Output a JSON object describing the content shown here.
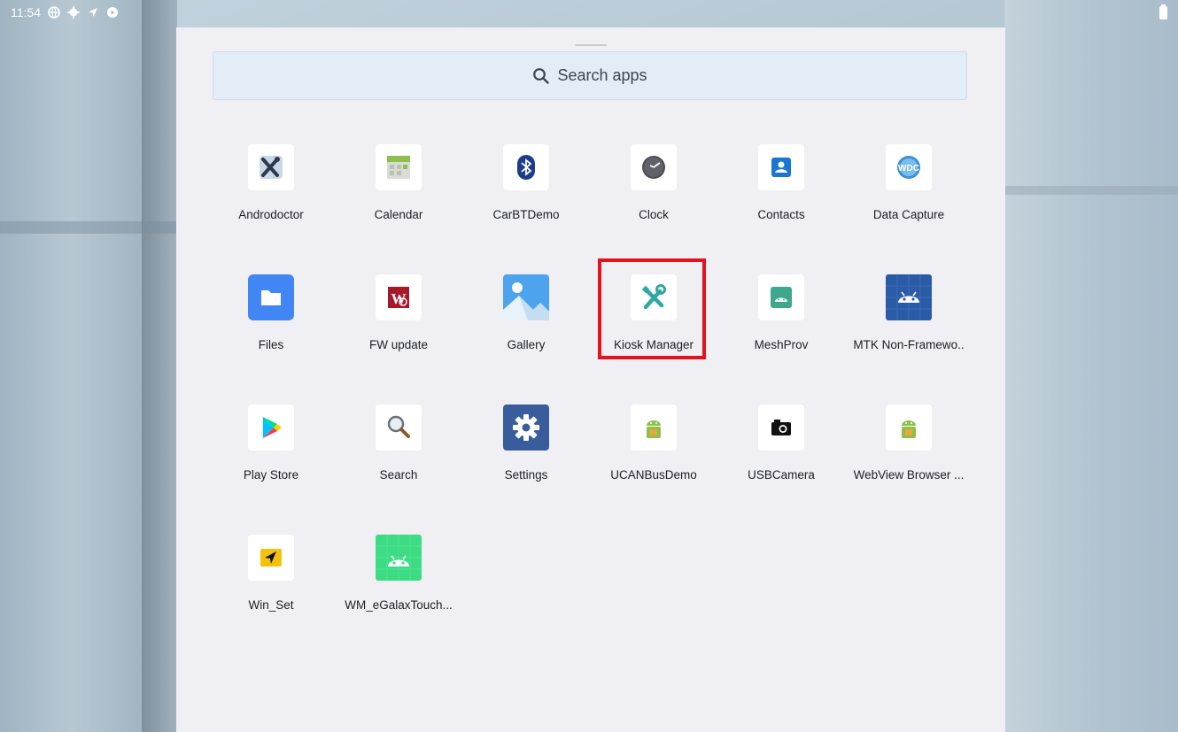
{
  "status_bar": {
    "time": "11:54",
    "icons": [
      "vpn-globe-icon",
      "settings-gear-icon",
      "location-arrow-icon",
      "shield-icon"
    ],
    "battery_icon": "battery-icon"
  },
  "search": {
    "placeholder": "Search apps",
    "icon": "search-icon"
  },
  "apps": [
    {
      "label": "Androdoctor",
      "icon": "androdoctor-icon"
    },
    {
      "label": "Calendar",
      "icon": "calendar-icon"
    },
    {
      "label": "CarBTDemo",
      "icon": "bluetooth-icon"
    },
    {
      "label": "Clock",
      "icon": "clock-icon"
    },
    {
      "label": "Contacts",
      "icon": "contacts-icon"
    },
    {
      "label": "Data Capture",
      "icon": "data-capture-icon"
    },
    {
      "label": "Files",
      "icon": "files-folder-icon"
    },
    {
      "label": "FW update",
      "icon": "fw-update-icon"
    },
    {
      "label": "Gallery",
      "icon": "gallery-icon"
    },
    {
      "label": "Kiosk Manager",
      "icon": "kiosk-manager-icon"
    },
    {
      "label": "MeshProv",
      "icon": "meshprov-android-icon"
    },
    {
      "label": "MTK Non-Framewo..",
      "icon": "mtk-android-icon"
    },
    {
      "label": "Play Store",
      "icon": "play-store-icon"
    },
    {
      "label": "Search",
      "icon": "magnifier-icon"
    },
    {
      "label": "Settings",
      "icon": "settings-icon"
    },
    {
      "label": "UCANBusDemo",
      "icon": "ucanbus-android-icon"
    },
    {
      "label": "USBCamera",
      "icon": "camera-icon"
    },
    {
      "label": "WebView Browser ...",
      "icon": "webview-android-icon"
    },
    {
      "label": "Win_Set",
      "icon": "win-set-arrow-icon"
    },
    {
      "label": "WM_eGalaxTouch...",
      "icon": "egalax-android-icon"
    }
  ],
  "highlighted_app": "Kiosk Manager",
  "colors": {
    "highlight": "#e4131b",
    "drawer_bg": "#efeff4",
    "search_bg": "#e3edf8"
  }
}
